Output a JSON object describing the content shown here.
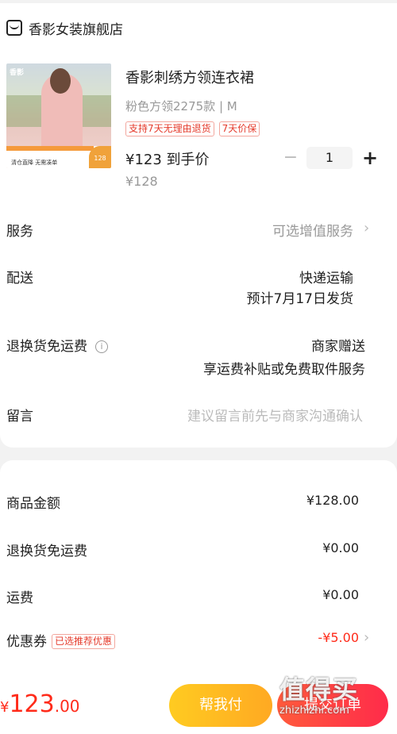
{
  "shop": {
    "name": "香影女装旗舰店",
    "icon": "shop-icon"
  },
  "product": {
    "title": "香影刺绣方领连衣裙",
    "spec": "粉色方领2275款 | M",
    "tags": [
      "支持7天无理由退货",
      "7天价保"
    ],
    "price_now": "¥123 到手价",
    "price_old": "¥128",
    "image_text": {
      "brand": "香影",
      "banner": "清仓直降 无需凑单",
      "badge": "128"
    },
    "quantity": "1",
    "minus": "−",
    "plus": "+"
  },
  "rows": {
    "service": {
      "label": "服务",
      "value": "可选增值服务"
    },
    "delivery": {
      "label": "配送",
      "value1": "快递运输",
      "value2": "预计7月17日发货"
    },
    "return_shipping": {
      "label": "退换货免运费",
      "value1": "商家赠送",
      "value2": "享运费补贴或免费取件服务"
    },
    "message": {
      "label": "留言",
      "placeholder": "建议留言前先与商家沟通确认"
    }
  },
  "summary": {
    "goods_amount": {
      "label": "商品金额",
      "value": "¥128.00"
    },
    "return_shipping": {
      "label": "退换货免运费",
      "value": "¥0.00"
    },
    "shipping": {
      "label": "运费",
      "value": "¥0.00"
    },
    "coupon": {
      "label": "优惠券",
      "tag": "已选推荐优惠",
      "value": "-¥5.00"
    }
  },
  "bottom": {
    "total_yen": "¥",
    "total_int": "123",
    "total_dec": ".00",
    "help_pay": "帮我付",
    "pay": "提交订单"
  },
  "watermark": {
    "big": "值得买",
    "small": "zhizhizhi.com"
  },
  "colors": {
    "accent_red": "#ff2b1a",
    "help_button": "#ffb822",
    "pay_button": "#ff3b3b"
  }
}
